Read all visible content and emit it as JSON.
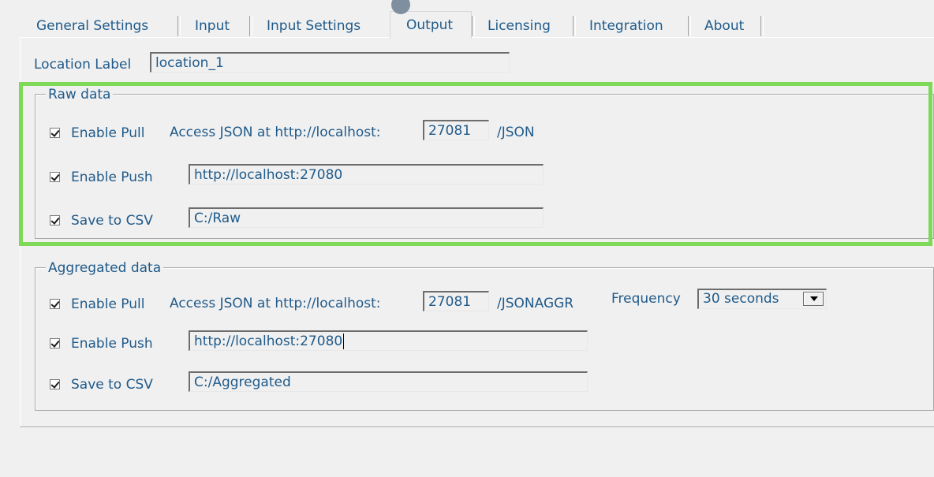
{
  "tabs": [
    {
      "label": "General Settings"
    },
    {
      "label": "Input"
    },
    {
      "label": "Input Settings"
    },
    {
      "label": "Output",
      "active": true
    },
    {
      "label": "Licensing"
    },
    {
      "label": "Integration"
    },
    {
      "label": "About"
    }
  ],
  "location": {
    "label": "Location Label",
    "value": "location_1"
  },
  "raw": {
    "title": "Raw data",
    "pull": {
      "label": "Enable Pull",
      "checked": true,
      "access_label": "Access JSON at http://localhost:",
      "port": "27081",
      "suffix": "/JSON"
    },
    "push": {
      "label": "Enable Push",
      "checked": true,
      "url": "http://localhost:27080"
    },
    "csv": {
      "label": "Save to CSV",
      "checked": true,
      "path": "C:/Raw"
    }
  },
  "aggregated": {
    "title": "Aggregated data",
    "pull": {
      "label": "Enable Pull",
      "checked": true,
      "access_label": "Access JSON at http://localhost:",
      "port": "27081",
      "suffix": "/JSONAGGR"
    },
    "frequency": {
      "label": "Frequency",
      "value": "30 seconds"
    },
    "push": {
      "label": "Enable Push",
      "checked": true,
      "url": "http://localhost:27080"
    },
    "csv": {
      "label": "Save to CSV",
      "checked": true,
      "path": "C:/Aggregated"
    }
  },
  "colors": {
    "text": "#1f5a8a",
    "highlight": "#7ed957",
    "background": "#f0f0f0"
  }
}
